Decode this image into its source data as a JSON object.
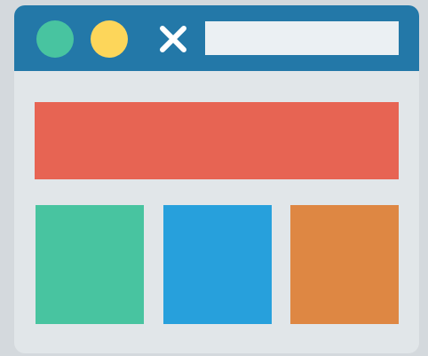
{
  "colors": {
    "background": "#d4d9dd",
    "window_body": "#e1e6e9",
    "titlebar": "#2378a8",
    "dot_green": "#48c4a0",
    "dot_yellow": "#fdd65a",
    "close_icon": "#ffffff",
    "address_bar": "#ebf0f3",
    "banner": "#e76453",
    "tile_green": "#48c4a0",
    "tile_blue": "#27a0dc",
    "tile_orange": "#de8743"
  },
  "titlebar": {
    "buttons": [
      {
        "icon": "green-circle-icon"
      },
      {
        "icon": "yellow-circle-icon"
      },
      {
        "icon": "close-icon"
      }
    ],
    "address_bar": {
      "value": "",
      "placeholder": ""
    }
  },
  "content": {
    "banner": {
      "icon": "banner-block"
    },
    "tiles": [
      {
        "icon": "green-tile"
      },
      {
        "icon": "blue-tile"
      },
      {
        "icon": "orange-tile"
      }
    ]
  }
}
